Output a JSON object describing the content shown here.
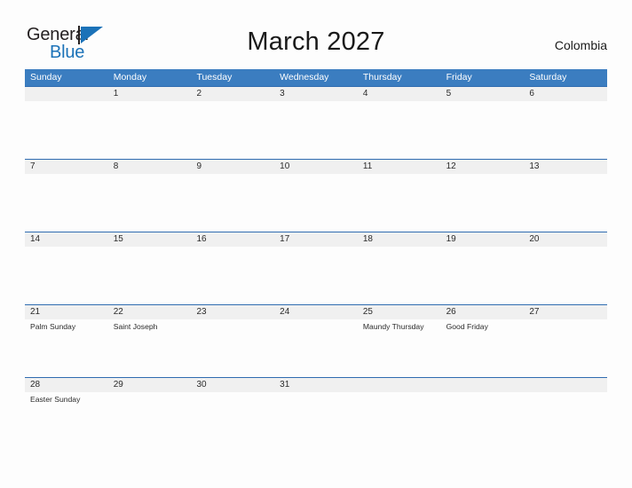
{
  "brand": {
    "name_top": "General",
    "name_bottom": "Blue",
    "accent_color": "#1b72b8",
    "dark_color": "#231f20"
  },
  "header": {
    "title": "March 2027",
    "country": "Colombia"
  },
  "calendar": {
    "header_bg": "#3b7dc0",
    "date_band_bg": "#f0f0f0",
    "rule_color": "#2f6cb0",
    "weekday_headers": [
      "Sunday",
      "Monday",
      "Tuesday",
      "Wednesday",
      "Thursday",
      "Friday",
      "Saturday"
    ],
    "weeks": [
      {
        "dates": [
          "",
          "1",
          "2",
          "3",
          "4",
          "5",
          "6"
        ],
        "events": [
          "",
          "",
          "",
          "",
          "",
          "",
          ""
        ]
      },
      {
        "dates": [
          "7",
          "8",
          "9",
          "10",
          "11",
          "12",
          "13"
        ],
        "events": [
          "",
          "",
          "",
          "",
          "",
          "",
          ""
        ]
      },
      {
        "dates": [
          "14",
          "15",
          "16",
          "17",
          "18",
          "19",
          "20"
        ],
        "events": [
          "",
          "",
          "",
          "",
          "",
          "",
          ""
        ]
      },
      {
        "dates": [
          "21",
          "22",
          "23",
          "24",
          "25",
          "26",
          "27"
        ],
        "events": [
          "Palm Sunday",
          "Saint Joseph",
          "",
          "",
          "Maundy Thursday",
          "Good Friday",
          ""
        ]
      },
      {
        "dates": [
          "28",
          "29",
          "30",
          "31",
          "",
          "",
          ""
        ],
        "events": [
          "Easter Sunday",
          "",
          "",
          "",
          "",
          "",
          ""
        ]
      }
    ]
  }
}
